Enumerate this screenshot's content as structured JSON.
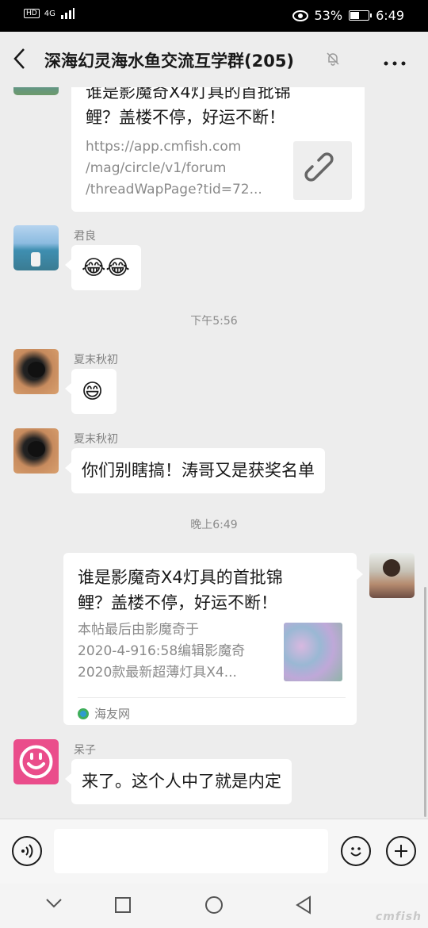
{
  "status_bar": {
    "network": "HD",
    "signal": "4G",
    "battery_percent": "53%",
    "battery_level": 0.53,
    "time": "6:49"
  },
  "header": {
    "title": "深海幻灵海水鱼交流互学群(205)",
    "back_icon": "chevron-left-icon",
    "mute_icon": "bell-off-icon",
    "more_icon": "more-icon"
  },
  "messages": {
    "m0_card": {
      "title_line1": "谁是影魔奇X4灯具的首批锦",
      "title_line2": "鲤？盖楼不停，好运不断！",
      "desc_line1": "https://app.cmfish.com",
      "desc_line2": "/mag/circle/v1/forum",
      "desc_line3": "/threadWapPage?tid=72..."
    },
    "m1": {
      "sender": "君良",
      "content": "😂😂"
    },
    "time1": "下午5:56",
    "m2": {
      "sender": "夏末秋初",
      "content": "😄"
    },
    "m3": {
      "sender": "夏末秋初",
      "content": "你们别瞎搞！涛哥又是获奖名单"
    },
    "time2": "晚上6:49",
    "m4_card": {
      "title_line1": "谁是影魔奇X4灯具的首批锦",
      "title_line2": "鲤？盖楼不停，好运不断！",
      "desc_line1": "本帖最后由影魔奇于",
      "desc_line2": "2020-4-916:58编辑影魔奇",
      "desc_line3": "2020款最新超薄灯具X4...",
      "source": "海友网"
    },
    "m5": {
      "sender": "呆子",
      "content": "来了。这个人中了就是内定"
    }
  },
  "input_bar": {
    "voice_icon": "voice-icon",
    "emoji_icon": "emoji-icon",
    "plus_icon": "plus-icon"
  },
  "nav_bar": {
    "back": "triangle-back-icon",
    "home": "circle-home-icon",
    "recents": "square-recents-icon",
    "down": "chevron-down-icon"
  },
  "watermark": "cmfish"
}
